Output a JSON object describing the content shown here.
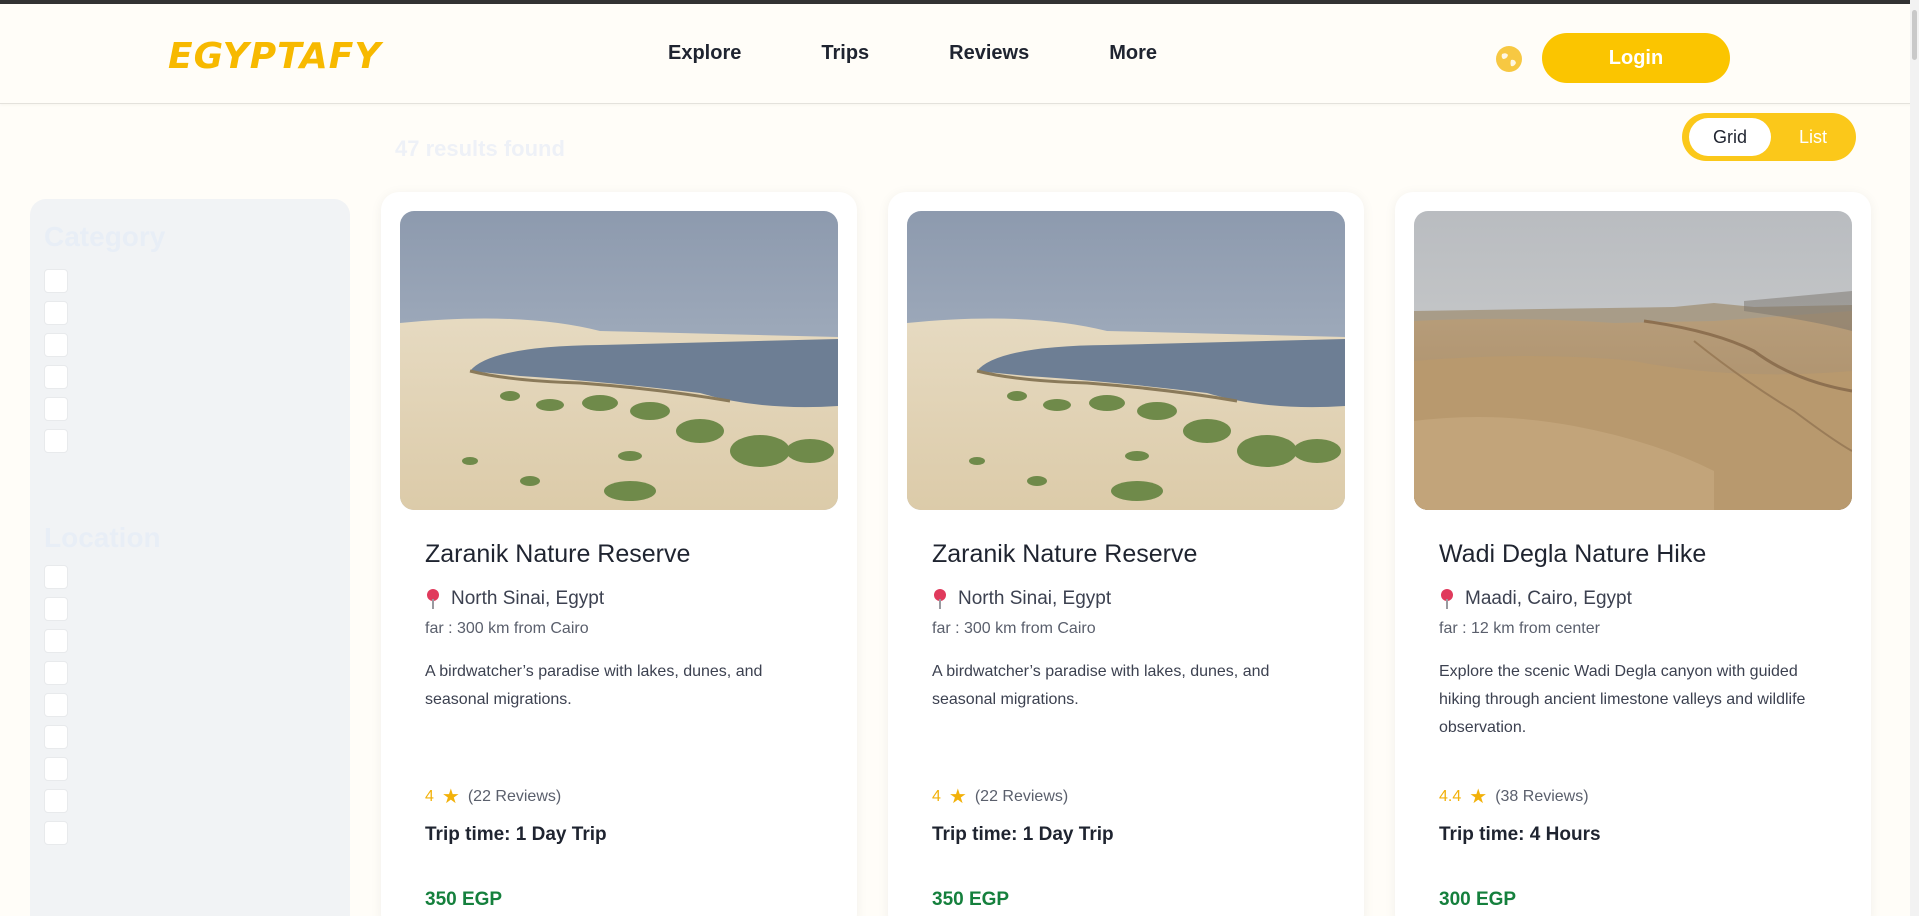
{
  "brand": {
    "logo_text": "EGYPTAFY",
    "accent": "#fbc500"
  },
  "nav": {
    "items": [
      "Explore",
      "Trips",
      "Reviews",
      "More"
    ]
  },
  "header": {
    "login_label": "Login",
    "globe_icon": "globe-icon"
  },
  "results": {
    "count_text": "47 results found"
  },
  "view_toggle": {
    "grid_label": "Grid",
    "list_label": "List",
    "selected": "Grid"
  },
  "sidebar": {
    "category_title": "Category",
    "category_items": [
      "",
      "",
      "",
      "",
      "",
      ""
    ],
    "location_title": "Location",
    "location_items": [
      "",
      "",
      "",
      "",
      "",
      "",
      "",
      "",
      ""
    ]
  },
  "cards": [
    {
      "title": "Zaranik Nature Reserve",
      "location": "North Sinai, Egypt",
      "far": "far : 300 km from Cairo",
      "description": "A birdwatcher’s paradise with lakes, dunes, and seasonal migrations.",
      "rating": "4",
      "reviews": "(22 Reviews)",
      "trip_time": "Trip time: 1 Day Trip",
      "price": "350 EGP",
      "image": "lagoon-dunes"
    },
    {
      "title": "Zaranik Nature Reserve",
      "location": "North Sinai, Egypt",
      "far": "far : 300 km from Cairo",
      "description": "A birdwatcher’s paradise with lakes, dunes, and seasonal migrations.",
      "rating": "4",
      "reviews": "(22 Reviews)",
      "trip_time": "Trip time: 1 Day Trip",
      "price": "350 EGP",
      "image": "lagoon-dunes"
    },
    {
      "title": "Wadi Degla Nature Hike",
      "location": "Maadi, Cairo, Egypt",
      "far": "far : 12 km from center",
      "description": "Explore the scenic Wadi Degla canyon with guided hiking through ancient limestone valleys and wildlife observation.",
      "rating": "4.4",
      "reviews": "(38 Reviews)",
      "trip_time": "Trip time: 4 Hours",
      "price": "300 EGP",
      "image": "desert-canyon"
    }
  ]
}
